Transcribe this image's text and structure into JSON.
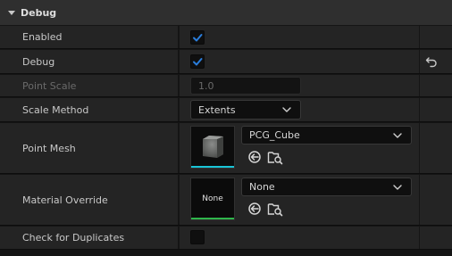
{
  "section": {
    "title": "Debug"
  },
  "colors": {
    "accent": "#2a7ddb",
    "mesh_asset_bar": "#19c4d6",
    "material_asset_bar": "#2fb64b"
  },
  "rows": {
    "enabled": {
      "label": "Enabled",
      "checked": true
    },
    "debug": {
      "label": "Debug",
      "checked": true,
      "reset_icon": "reset-to-default-icon"
    },
    "point_scale": {
      "label": "Point Scale",
      "value": "1.0",
      "disabled": true
    },
    "scale_method": {
      "label": "Scale Method",
      "selected": "Extents"
    },
    "point_mesh": {
      "label": "Point Mesh",
      "selected": "PCG_Cube",
      "thumbnail": "cube-mesh-thumbnail",
      "icons": [
        "use-selected-asset-icon",
        "browse-to-asset-icon"
      ]
    },
    "material_override": {
      "label": "Material Override",
      "selected": "None",
      "thumbnail_text": "None",
      "icons": [
        "use-selected-asset-icon",
        "browse-to-asset-icon"
      ]
    },
    "check_duplicates": {
      "label": "Check for Duplicates",
      "checked": false
    }
  }
}
